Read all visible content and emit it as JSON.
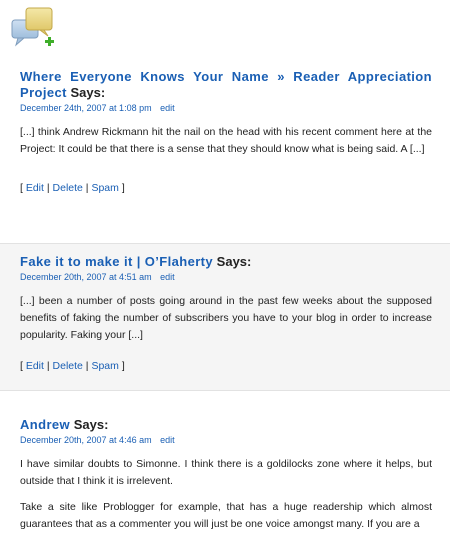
{
  "comments": [
    {
      "author": "Where Everyone Knows Your Name » Reader Appreciation Project",
      "says": "Says:",
      "date": "December 24th, 2007 at 1:08 pm",
      "edit": "edit",
      "paragraphs": [
        "[...] think Andrew Rickmann hit the nail on the head with his recent comment here at the Project: It could be that there is a sense that they should know what is being said. A [...]"
      ],
      "actions": {
        "open": "[",
        "edit": "Edit",
        "sep1": "|",
        "delete": "Delete",
        "sep2": "|",
        "spam": "Spam",
        "close": "]"
      }
    },
    {
      "author": "Fake it to make it | O’Flaherty",
      "says": "Says:",
      "date": "December 20th, 2007 at 4:51 am",
      "edit": "edit",
      "paragraphs": [
        "[...] been a number of posts going around in the past few weeks about the supposed benefits of faking the number of subscribers you have to your blog in order to increase popularity. Faking your [...]"
      ],
      "actions": {
        "open": "[",
        "edit": "Edit",
        "sep1": "|",
        "delete": "Delete",
        "sep2": "|",
        "spam": "Spam",
        "close": "]"
      }
    },
    {
      "author": "Andrew",
      "says": "Says:",
      "date": "December 20th, 2007 at 4:46 am",
      "edit": "edit",
      "paragraphs": [
        "I have similar doubts to Simonne. I think there is a goldilocks zone where it helps, but outside that I think it is irrelevent.",
        "Take a site like Problogger for example, that has a huge readership which almost guarantees that as a commenter you will just be one voice amongst many. If you are a"
      ]
    }
  ]
}
